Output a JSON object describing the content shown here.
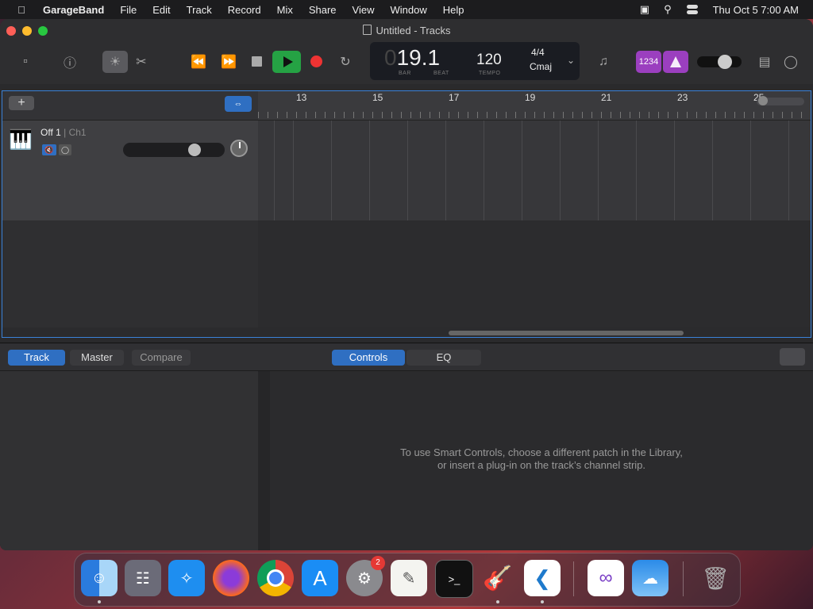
{
  "menubar": {
    "app_name": "GarageBand",
    "items": [
      "File",
      "Edit",
      "Track",
      "Record",
      "Mix",
      "Share",
      "View",
      "Window",
      "Help"
    ],
    "clock": "Thu Oct 5  7:00 AM"
  },
  "window": {
    "title": "Untitled - Tracks"
  },
  "lcd": {
    "bar_leading": "0",
    "position": "19.1",
    "bar_label": "BAR",
    "beat_label": "BEAT",
    "tempo": "120",
    "tempo_label": "TEMPO",
    "time_signature": "4/4",
    "key": "Cmaj"
  },
  "toolbar": {
    "count_in_label": "1234"
  },
  "tracks": {
    "add_label": "+",
    "track": {
      "name": "Off 1",
      "channel": "| Ch1"
    }
  },
  "ruler": {
    "bars": [
      "13",
      "15",
      "17",
      "19",
      "21",
      "23",
      "25"
    ]
  },
  "smart_controls": {
    "tabs_left": [
      "Track",
      "Master",
      "Compare"
    ],
    "tabs_right": [
      "Controls",
      "EQ"
    ],
    "message_line1": "To use Smart Controls, choose a different patch in the Library,",
    "message_line2": "or insert a plug-in on the track’s channel strip."
  },
  "dock": {
    "apps": [
      "Finder",
      "Launchpad",
      "Safari",
      "Firefox",
      "Chrome",
      "App Store",
      "System Settings",
      "TextEdit",
      "Terminal",
      "GarageBand",
      "Visual Studio Code",
      "Visual Studio",
      "Weather",
      "Trash"
    ],
    "settings_badge": "2"
  },
  "colors": {
    "accent": "#2f6fc2",
    "play": "#25a244",
    "record": "#e33333",
    "purple": "#9b3fbf"
  }
}
